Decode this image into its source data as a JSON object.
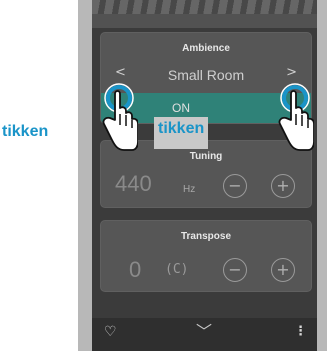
{
  "ambience": {
    "title": "Ambience",
    "prev_label": "<",
    "next_label": ">",
    "value": "Small Room",
    "toggle_label": "ON"
  },
  "tuning": {
    "title": "Tuning",
    "value": "440",
    "unit": "Hz",
    "minus_label": "−",
    "plus_label": "+"
  },
  "transpose": {
    "title": "Transpose",
    "value": "0",
    "key": "(C)",
    "minus_label": "−",
    "plus_label": "+"
  },
  "footer": {
    "heart_icon": "♡",
    "chevron_icon": "﹀",
    "menu_icon": "⋮"
  },
  "annotations": {
    "tap_left": "tikken",
    "tap_right": "tikken"
  },
  "colors": {
    "accent": "#2f8278",
    "annotation": "#1a94c8"
  }
}
